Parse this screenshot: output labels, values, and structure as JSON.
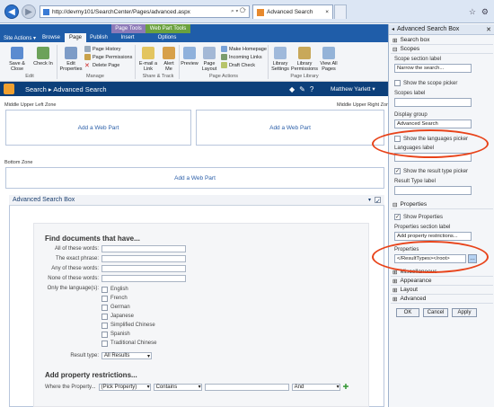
{
  "browser": {
    "url": "http://devmy101/SearchCenter/Pages/advanced.aspx",
    "tab_title": "Advanced Search",
    "tab_close": "×",
    "window_controls": [
      "☆",
      "⚙"
    ]
  },
  "ribbon": {
    "site_actions": "Site Actions ▾",
    "tabs": [
      "Browse",
      "Page",
      "Publish",
      "Insert",
      "Options"
    ],
    "context_groups": [
      "Page Tools",
      "Web Part Tools"
    ],
    "edit_group": {
      "save_close": "Save & Close",
      "check_in": "Check In",
      "label": "Edit"
    },
    "manage_group": {
      "edit_props": "Edit Properties",
      "page_history": "Page History",
      "page_permissions": "Page Permissions",
      "delete_page": "Delete Page",
      "label": "Manage"
    },
    "share_group": {
      "email_link": "E-mail a Link",
      "alert_me": "Alert Me",
      "label": "Share & Track"
    },
    "page_actions_group": {
      "preview": "Preview",
      "page_layout": "Page Layout",
      "make_homepage": "Make Homepage",
      "incoming_links": "Incoming Links",
      "draft_check": "Draft Check",
      "label": "Page Actions"
    },
    "library_group": {
      "library_settings": "Library Settings",
      "library_permissions": "Library Permissions",
      "view_all_pages": "View All Pages",
      "label": "Page Library"
    }
  },
  "header": {
    "breadcrumb": "Search ▸ Advanced Search",
    "user": "Matthew Yarlett ▾"
  },
  "zones": {
    "upper_left": "Middle Upper Left Zone",
    "upper_right": "Middle Upper Right Zone",
    "bottom": "Bottom Zone",
    "add_web_part": "Add a Web Part"
  },
  "webpart": {
    "title": "Advanced Search Box",
    "find_heading": "Find documents that have...",
    "fields": [
      "All of these words:",
      "The exact phrase:",
      "Any of these words:",
      "None of these words:"
    ],
    "language_label": "Only the language(s):",
    "languages": [
      "English",
      "French",
      "German",
      "Japanese",
      "Simplified Chinese",
      "Spanish",
      "Traditional Chinese"
    ],
    "result_type_label": "Result type:",
    "result_type_value": "All Results",
    "property_heading": "Add property restrictions...",
    "where_label": "Where the Property...",
    "pick_property": "(Pick Property)",
    "contains": "Contains",
    "and": "And"
  },
  "toolpane": {
    "title": "Advanced Search Box",
    "search_box": "Search box",
    "scopes": "Scopes",
    "scope_section_label": "Scope section label",
    "scope_section_value": "Narrow the search...",
    "show_scope_picker": "Show the scope picker",
    "scopes_label": "Scopes label",
    "display_group": "Display group",
    "display_group_value": "Advanced Search",
    "show_languages_picker": "Show the languages picker",
    "languages_label": "Languages label",
    "show_result_type_picker": "Show the result type picker",
    "result_type_label": "Result Type label",
    "properties": "Properties",
    "show_properties": "Show Properties",
    "properties_section_label": "Properties section label",
    "properties_section_value": "Add property restrictions...",
    "properties_field_label": "Properties",
    "properties_value": "</ResultTypes></root>",
    "collapsed": [
      "Miscellaneous",
      "Appearance",
      "Layout",
      "Advanced"
    ],
    "ok": "OK",
    "cancel": "Cancel",
    "apply": "Apply"
  },
  "colors": {
    "highlight": "#e8431a",
    "ribbon": "#1f5da9",
    "header": "#0c3f7a"
  }
}
